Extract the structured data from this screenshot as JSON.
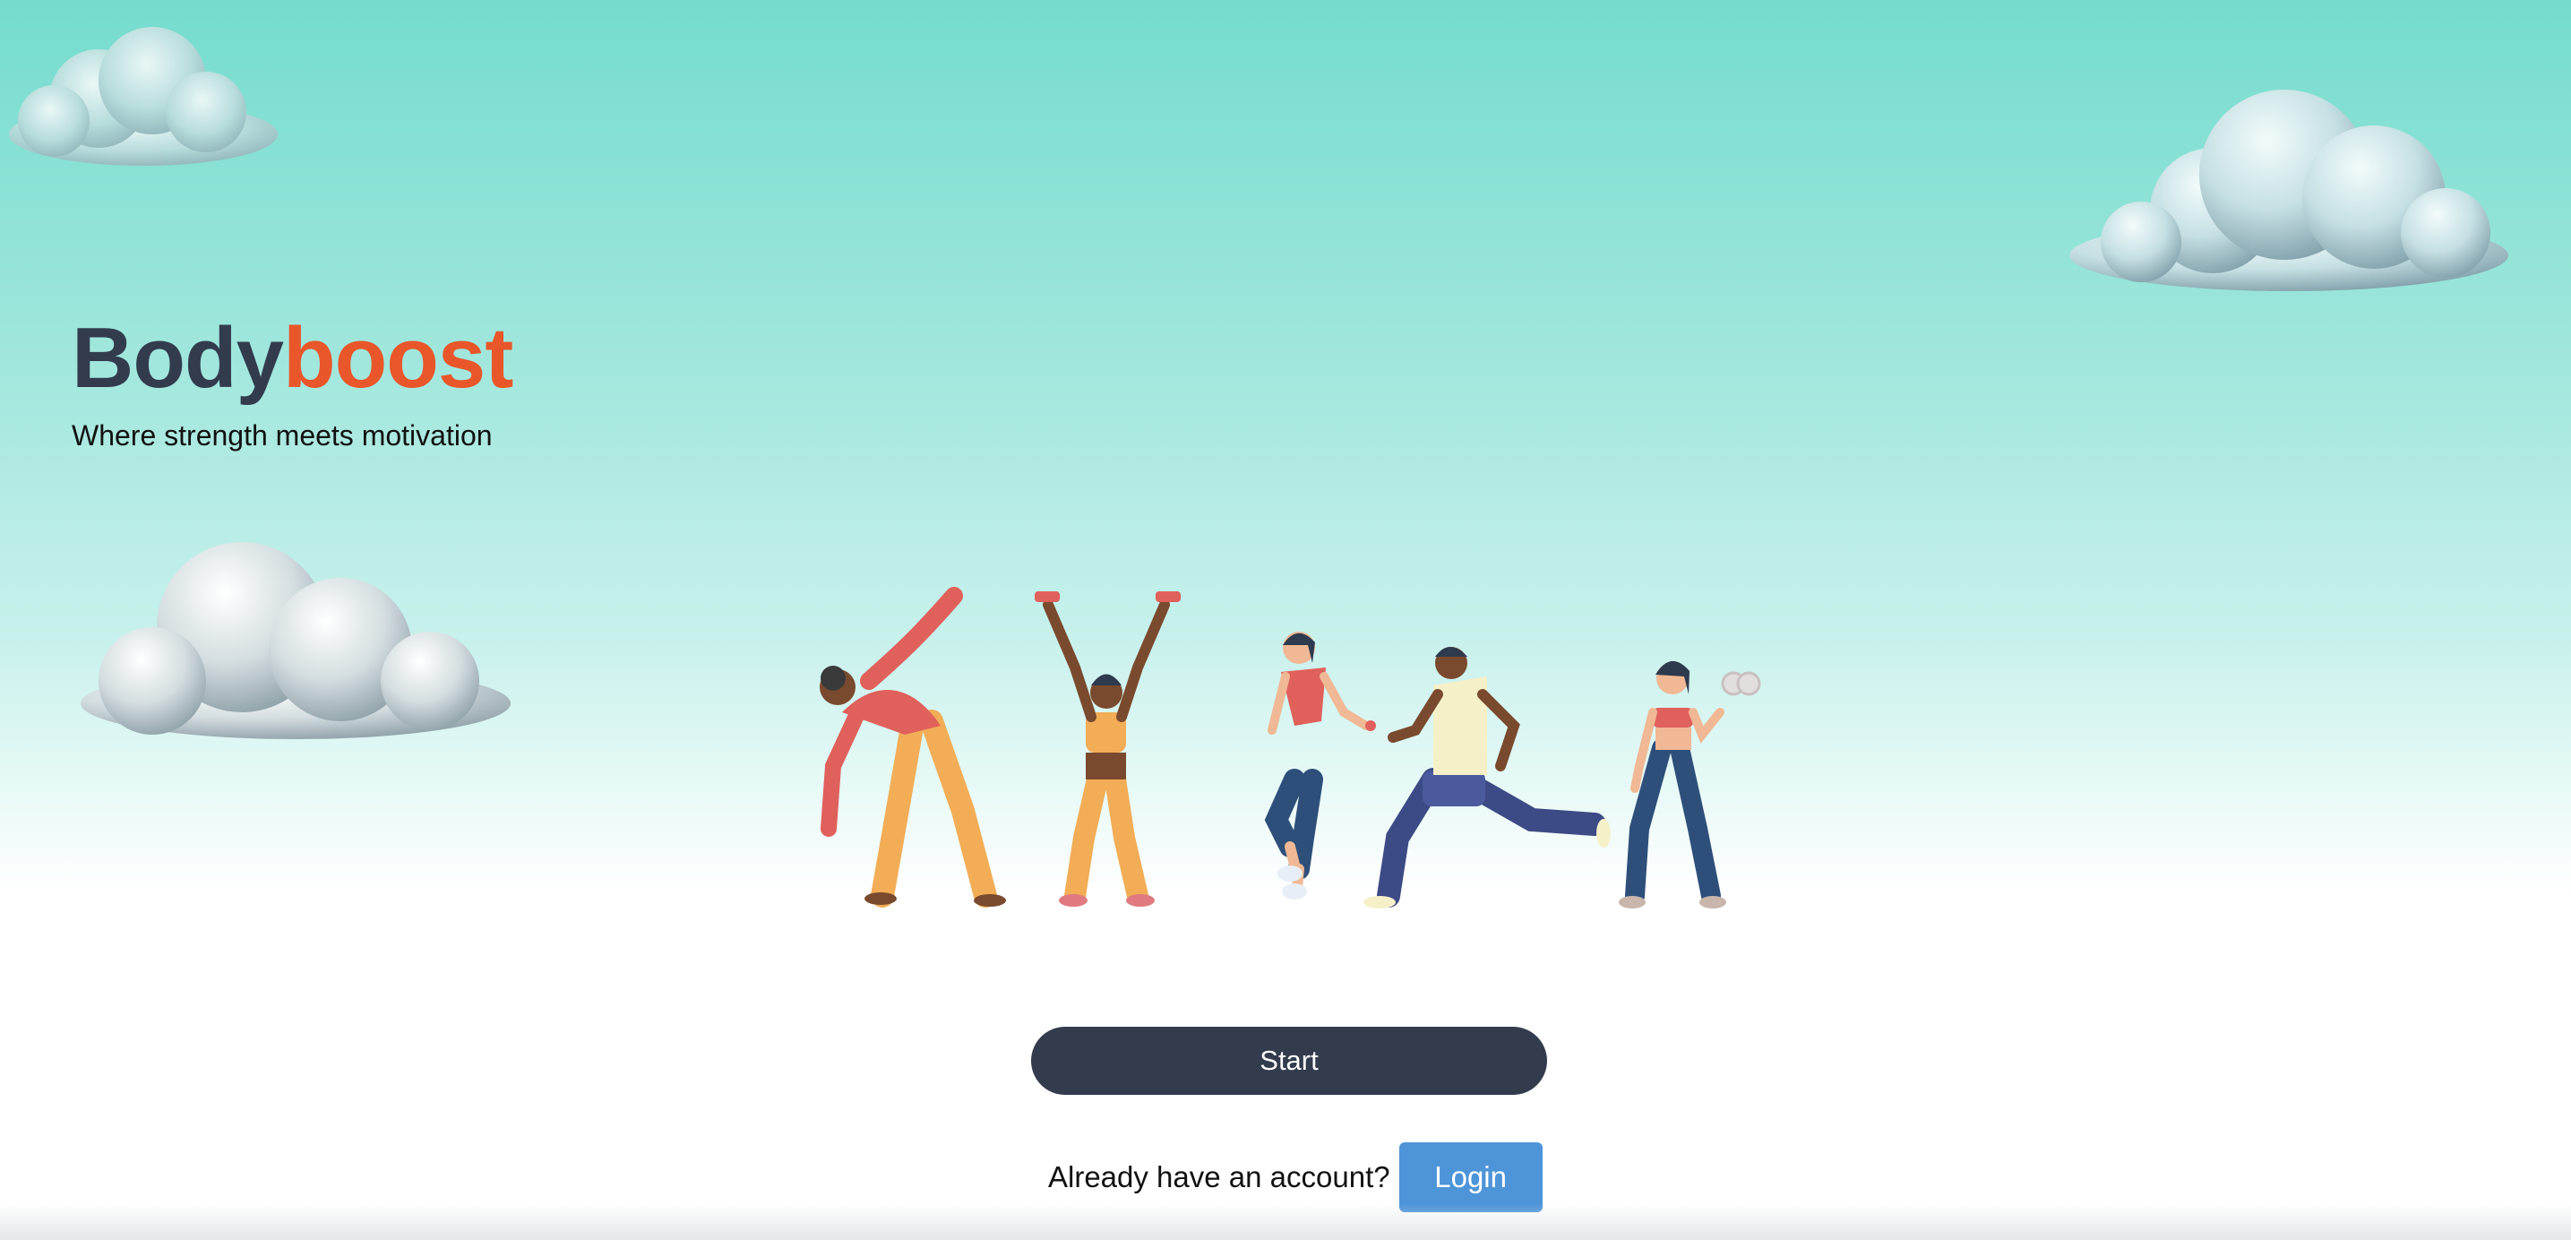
{
  "brand": {
    "name_part1": "Body",
    "name_part2": "boost",
    "tagline": "Where strength meets motivation"
  },
  "actions": {
    "start_label": "Start",
    "login_prompt": "Already have an account?",
    "login_label": "Login"
  },
  "colors": {
    "sky_top": "#74dccd",
    "brand_dark": "#323c4d",
    "brand_accent": "#e8562a",
    "login_blue": "#4e94d8"
  }
}
